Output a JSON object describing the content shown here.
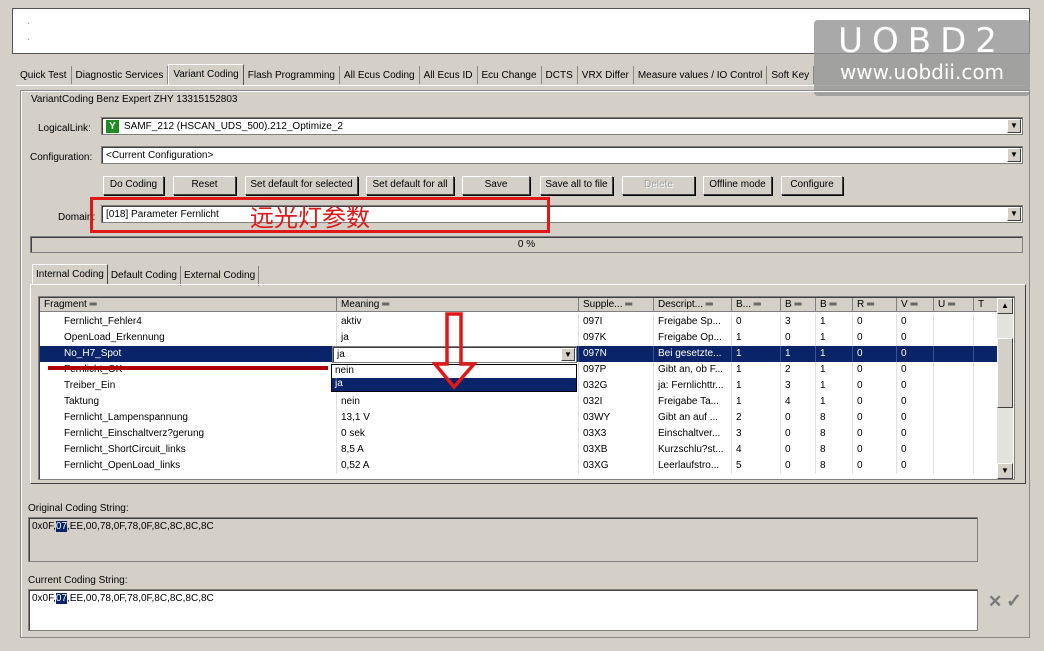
{
  "watermark": {
    "brand": "UOBD2",
    "url": "www.uobdii.com"
  },
  "tabs": [
    "Quick Test",
    "Diagnostic Services",
    "Variant Coding",
    "Flash Programming",
    "All Ecus Coding",
    "All Ecus ID",
    "Ecu Change",
    "DCTS",
    "VRX Differ",
    "Measure values / IO Control",
    "Soft Key"
  ],
  "group_title": "VariantCoding Benz Expert ZHY 13315152803",
  "logical_link": {
    "label": "LogicalLink:",
    "value": "SAMF_212 (HSCAN_UDS_500).212_Optimize_2",
    "badge": "Y"
  },
  "configuration": {
    "label": "Configuration:",
    "value": "<Current Configuration>"
  },
  "buttons": {
    "do_coding": "Do Coding",
    "reset": "Reset",
    "set_default_selected": "Set default for selected",
    "set_default_all": "Set default for all",
    "save": "Save",
    "save_all_file": "Save all to file",
    "delete": "Delete",
    "offline_mode": "Offline mode",
    "configure": "Configure"
  },
  "domain": {
    "label": "Domain:",
    "value": "[018] Parameter Fernlicht",
    "annotation": "远光灯参数"
  },
  "progress": {
    "text": "0 %",
    "value": 0
  },
  "subtabs": [
    "Internal Coding",
    "Default Coding",
    "External Coding"
  ],
  "table": {
    "headers": [
      "Fragment",
      "Meaning",
      "Supple...",
      "Descript...",
      "B...",
      "B",
      "B",
      "R",
      "V",
      "U",
      "T"
    ],
    "rows": [
      [
        "Fernlicht_Fehler4",
        "aktiv",
        "097I",
        "Freigabe Sp...",
        "0",
        "3",
        "1",
        "0",
        "0",
        "",
        ""
      ],
      [
        "OpenLoad_Erkennung",
        "ja",
        "097K",
        "Freigabe Op...",
        "1",
        "0",
        "1",
        "0",
        "0",
        "",
        ""
      ],
      [
        "No_H7_Spot",
        "ja",
        "097N",
        "Bei gesetzte...",
        "1",
        "1",
        "1",
        "0",
        "0",
        "",
        ""
      ],
      [
        "Fernlicht_OK",
        "",
        "097P",
        "Gibt an, ob F...",
        "1",
        "2",
        "1",
        "0",
        "0",
        "",
        ""
      ],
      [
        "Treiber_Ein",
        "",
        "032G",
        "ja: Fernlichttr...",
        "1",
        "3",
        "1",
        "0",
        "0",
        "",
        ""
      ],
      [
        "Taktung",
        "nein",
        "032I",
        "Freigabe Ta...",
        "1",
        "4",
        "1",
        "0",
        "0",
        "",
        ""
      ],
      [
        "Fernlicht_Lampenspannung",
        "13,1 V",
        "03WY",
        "Gibt an auf ...",
        "2",
        "0",
        "8",
        "0",
        "0",
        "",
        ""
      ],
      [
        "Fernlicht_Einschaltverz?gerung",
        "0 sek",
        "03X3",
        "Einschaltver...",
        "3",
        "0",
        "8",
        "0",
        "0",
        "",
        ""
      ],
      [
        "Fernlicht_ShortCircuit_links",
        "8,5 A",
        "03XB",
        "Kurzschlu?st...",
        "4",
        "0",
        "8",
        "0",
        "0",
        "",
        ""
      ],
      [
        "Fernlicht_OpenLoad_links",
        "0,52 A",
        "03XG",
        "Leerlaufstro...",
        "5",
        "0",
        "8",
        "0",
        "0",
        "",
        ""
      ]
    ],
    "selected_row": 2,
    "dropdown_options": [
      "nein",
      "ja"
    ],
    "dropdown_selected": "ja"
  },
  "original_coding": {
    "label": "Original Coding String:",
    "prefix": "0x0F,",
    "highlight": "07",
    "rest": ",EE,00,78,0F,78,0F,8C,8C,8C,8C"
  },
  "current_coding": {
    "label": "Current Coding String:",
    "prefix": "0x0F,",
    "highlight": "07",
    "rest": ",EE,00,78,0F,78,0F,8C,8C,8C,8C"
  },
  "icons": {
    "arrow": "down-arrow-icon",
    "cancel": "cross-icon",
    "accept": "check-icon"
  },
  "colors": {
    "annotation_red": "#e01818",
    "selection_blue": "#0a246a",
    "badge_green": "#1e8c1e"
  }
}
